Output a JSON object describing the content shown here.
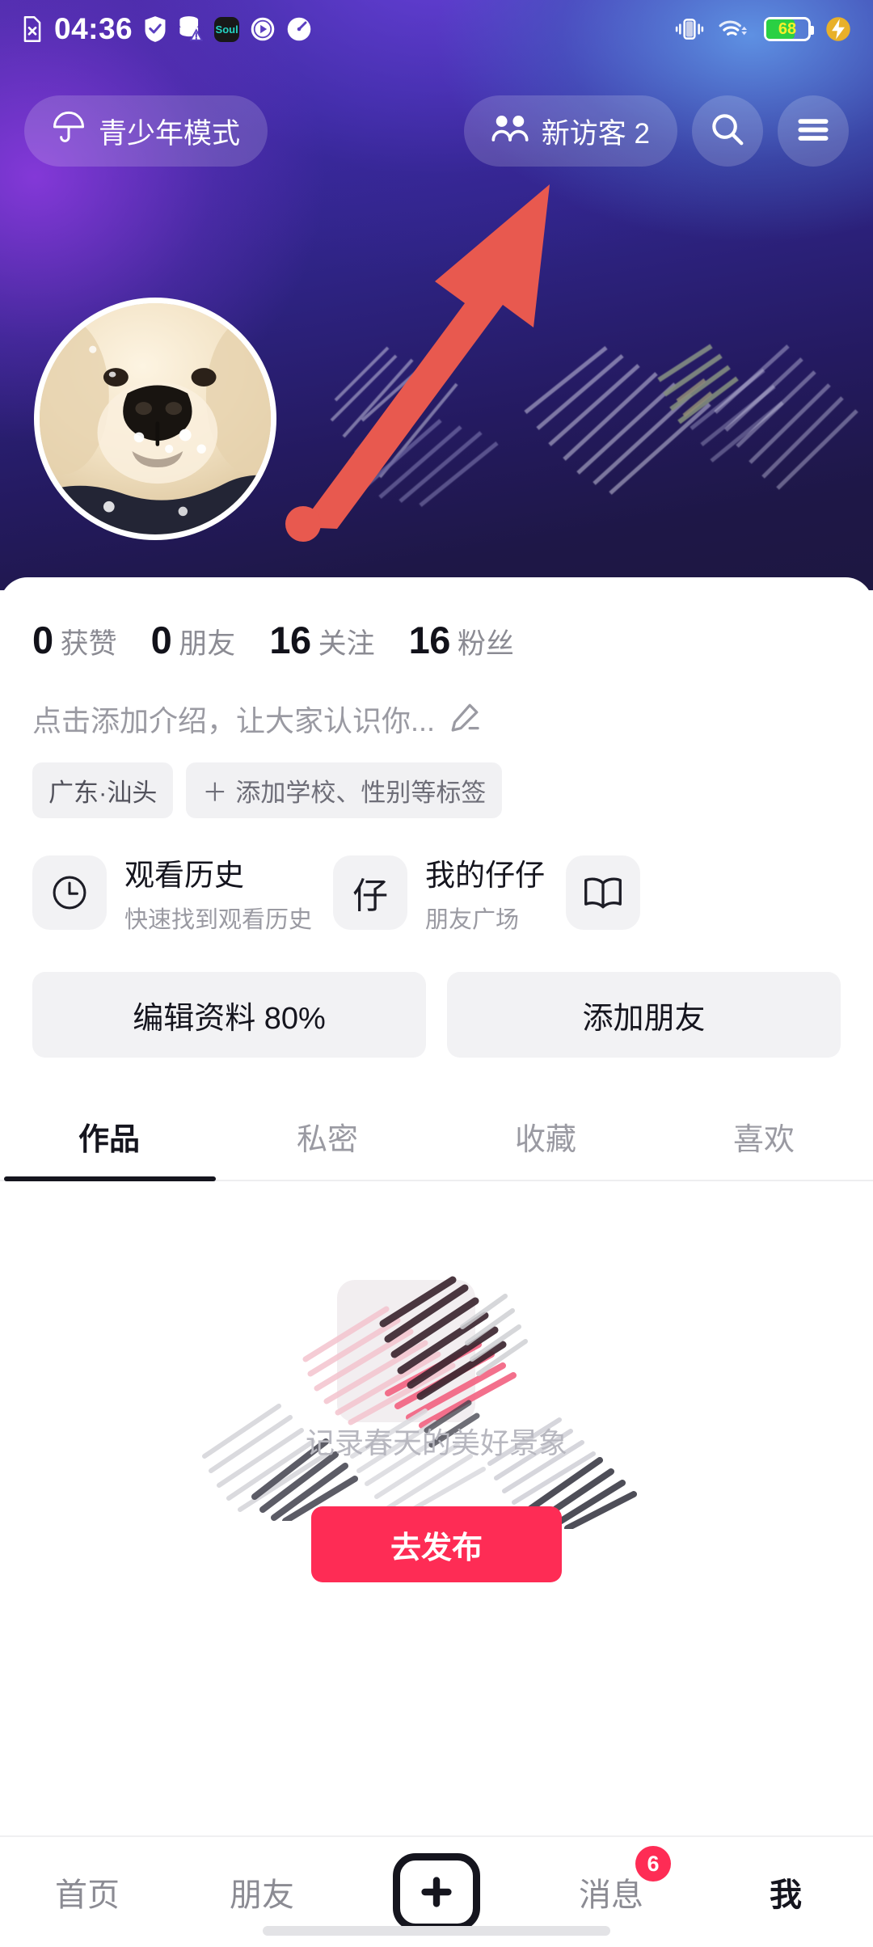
{
  "status_bar": {
    "time": "04:36",
    "battery_percent": "68",
    "left_icons": [
      "sim-card-off-icon",
      "shield-check-icon",
      "database-warning-icon",
      "soul-app-icon",
      "play-circle-icon",
      "speed-meter-icon"
    ],
    "right_icons": [
      "vibrate-icon",
      "wifi-icon",
      "battery-icon",
      "fast-charge-icon"
    ],
    "app_icon_text": "Soul"
  },
  "header": {
    "teen_mode_label": "青少年模式",
    "visitors_label": "新访客 2",
    "search_icon": "search-icon",
    "menu_icon": "hamburger-menu-icon",
    "teen_mode_icon": "umbrella-icon",
    "visitors_icon": "people-icon"
  },
  "annotation": {
    "arrow_color": "#e8594f",
    "arrow_target": "新访客 2"
  },
  "profile": {
    "avatar_alt": "golden-retriever-puppy-avatar",
    "stats": [
      {
        "num": "0",
        "label": "获赞"
      },
      {
        "num": "0",
        "label": "朋友"
      },
      {
        "num": "16",
        "label": "关注"
      },
      {
        "num": "16",
        "label": "粉丝"
      }
    ],
    "bio_placeholder": "点击添加介绍，让大家认识你...",
    "bio_edit_icon": "pencil-icon",
    "tags": [
      {
        "text": "广东·汕头",
        "plus": false
      },
      {
        "text": "添加学校、性别等标签",
        "plus": true
      }
    ]
  },
  "quick_cards": [
    {
      "icon": "clock-icon",
      "glyph": "",
      "title": "观看历史",
      "subtitle": "快速找到观看历史"
    },
    {
      "icon": "zai-char-icon",
      "glyph": "仔",
      "title": "我的仔仔",
      "subtitle": "朋友广场"
    },
    {
      "icon": "book-icon",
      "glyph": "",
      "title": "",
      "subtitle": ""
    }
  ],
  "action_buttons": [
    {
      "label": "编辑资料 80%"
    },
    {
      "label": "添加朋友"
    }
  ],
  "tabs": [
    {
      "label": "作品",
      "active": true
    },
    {
      "label": "私密",
      "active": false
    },
    {
      "label": "收藏",
      "active": false
    },
    {
      "label": "喜欢",
      "active": false
    }
  ],
  "empty_state": {
    "caption": "记录春天的美好景象",
    "publish_label": "去发布",
    "publish_color": "#fe2c55"
  },
  "bottom_nav": {
    "items": [
      {
        "label": "首页",
        "active": false,
        "badge": ""
      },
      {
        "label": "朋友",
        "active": false,
        "badge": ""
      },
      {
        "label": "",
        "active": false,
        "badge": "",
        "icon": "plus-create-icon"
      },
      {
        "label": "消息",
        "active": false,
        "badge": "6"
      },
      {
        "label": "我",
        "active": true,
        "badge": ""
      }
    ]
  }
}
